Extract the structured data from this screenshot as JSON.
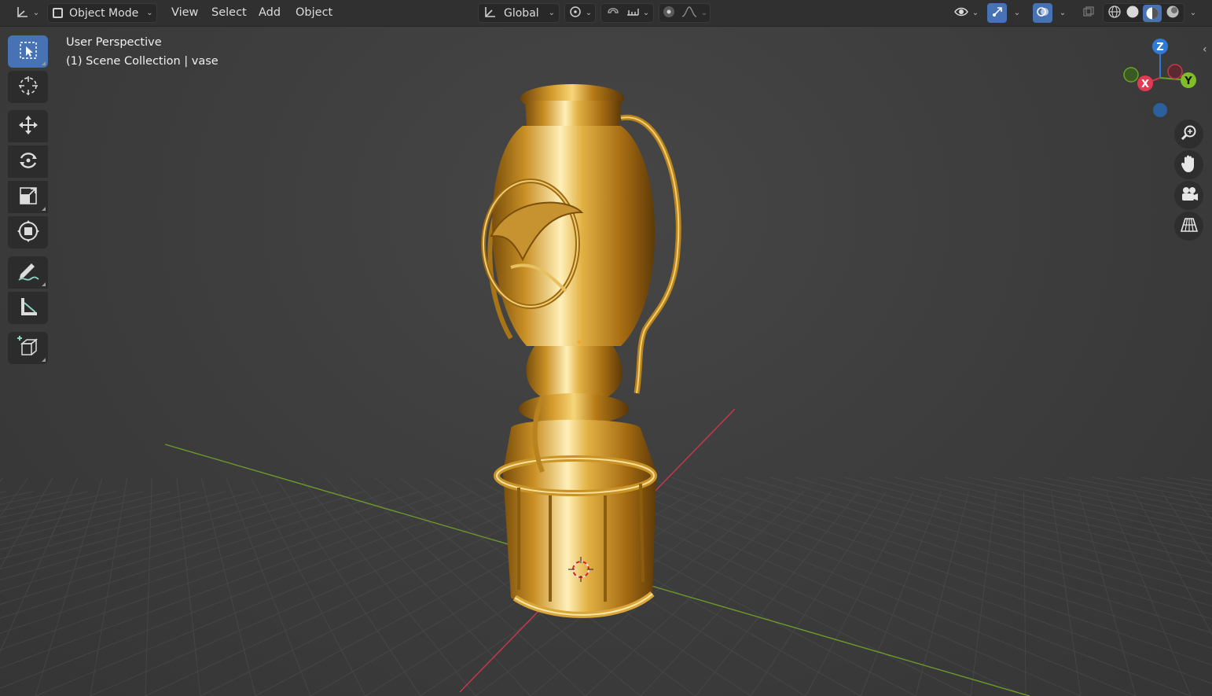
{
  "header": {
    "mode_label": "Object Mode",
    "menu": {
      "view": "View",
      "select": "Select",
      "add": "Add",
      "object": "Object"
    },
    "orientation_label": "Global",
    "shading_active": "material-preview"
  },
  "overlay": {
    "view_name": "User Perspective",
    "collection_info": "(1) Scene Collection | vase"
  },
  "gizmo": {
    "z_label": "Z",
    "x_label": "X",
    "y_label": "Y"
  },
  "toolbar": {
    "tools": [
      "select-box",
      "cursor",
      "move",
      "rotate",
      "scale",
      "transform",
      "annotate",
      "measure",
      "add-cube"
    ],
    "active": "select-box"
  },
  "colors": {
    "accent": "#4772b3",
    "x_axis": "#ff3352",
    "y_axis": "#8bdc00",
    "z_axis": "#2890ff",
    "gold": "#d4a32c"
  }
}
